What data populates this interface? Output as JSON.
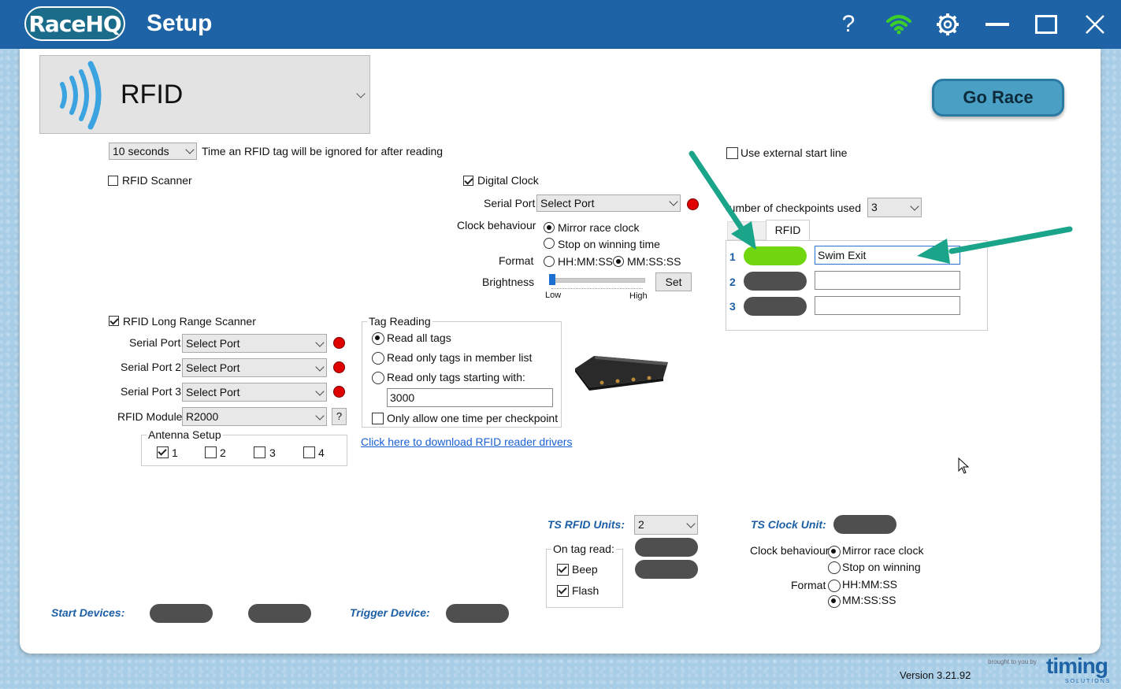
{
  "app": {
    "logo": "RaceHQ",
    "title": "Setup",
    "version": "Version 3.21.92",
    "brand_tagline": "brought to you by",
    "brand_name": "timing",
    "brand_sub": "SOLUTIONS"
  },
  "header": {
    "device_label": "RFID",
    "go_race_label": "Go Race"
  },
  "ignore": {
    "value": "10 seconds",
    "desc": "Time an RFID tag will be ignored for after reading"
  },
  "rfid_scanner": {
    "label": "RFID Scanner",
    "checked": false
  },
  "digital_clock": {
    "label": "Digital Clock",
    "serial_port_label": "Serial Port",
    "serial_port_value": "Select Port",
    "behaviour_label": "Clock behaviour",
    "mirror_label": "Mirror race clock",
    "stop_label": "Stop on winning time",
    "format_label": "Format",
    "fmt_hhmmss": "HH:MM:SS",
    "fmt_mmss": "MM:SS:SS",
    "brightness_label": "Brightness",
    "low": "Low",
    "high": "High",
    "brightness_level": 0,
    "set_label": "Set"
  },
  "external": {
    "label": "Use external start line"
  },
  "checkpoints": {
    "label": "Number of checkpoints used:",
    "value": "3",
    "tab": "RFID",
    "rows": [
      {
        "num": "1",
        "name": "Swim Exit"
      },
      {
        "num": "2",
        "name": ""
      },
      {
        "num": "3",
        "name": ""
      }
    ]
  },
  "long_range": {
    "label": "RFID Long Range Scanner",
    "port1_label": "Serial Port",
    "port2_label": "Serial Port 2",
    "port3_label": "Serial Port 3",
    "port_value": "Select Port",
    "module_label": "RFID Module",
    "module_value": "R2000",
    "help": "?",
    "antenna_title": "Antenna Setup",
    "antennas": [
      "1",
      "2",
      "3",
      "4"
    ]
  },
  "tag_reading": {
    "title": "Tag Reading",
    "all": "Read all tags",
    "member": "Read only tags in member list",
    "starting": "Read only tags starting with:",
    "prefix": "3000",
    "once": "Only allow one time per checkpoint"
  },
  "drivers_link": "Click here to download RFID reader drivers",
  "ts_rfid": {
    "label": "TS RFID Units:",
    "value": "2",
    "on_tag_title": "On tag read:",
    "beep": "Beep",
    "flash": "Flash"
  },
  "ts_clock": {
    "label": "TS Clock Unit:",
    "behaviour_label": "Clock behaviour",
    "mirror": "Mirror race clock",
    "stop": "Stop on winning",
    "format_label": "Format",
    "fmt_hhmmss": "HH:MM:SS",
    "fmt_mmss": "MM:SS:SS"
  },
  "footer": {
    "start_devices": "Start Devices:",
    "trigger_device": "Trigger Device:"
  },
  "colors": {
    "titlebar": "#1d63a5",
    "green_pill": "#6fd60f",
    "grey_pill": "#4f4f4f",
    "red_dot": "#e00000",
    "arrow": "#1aa58a",
    "go_race": "#4a9fc4"
  }
}
